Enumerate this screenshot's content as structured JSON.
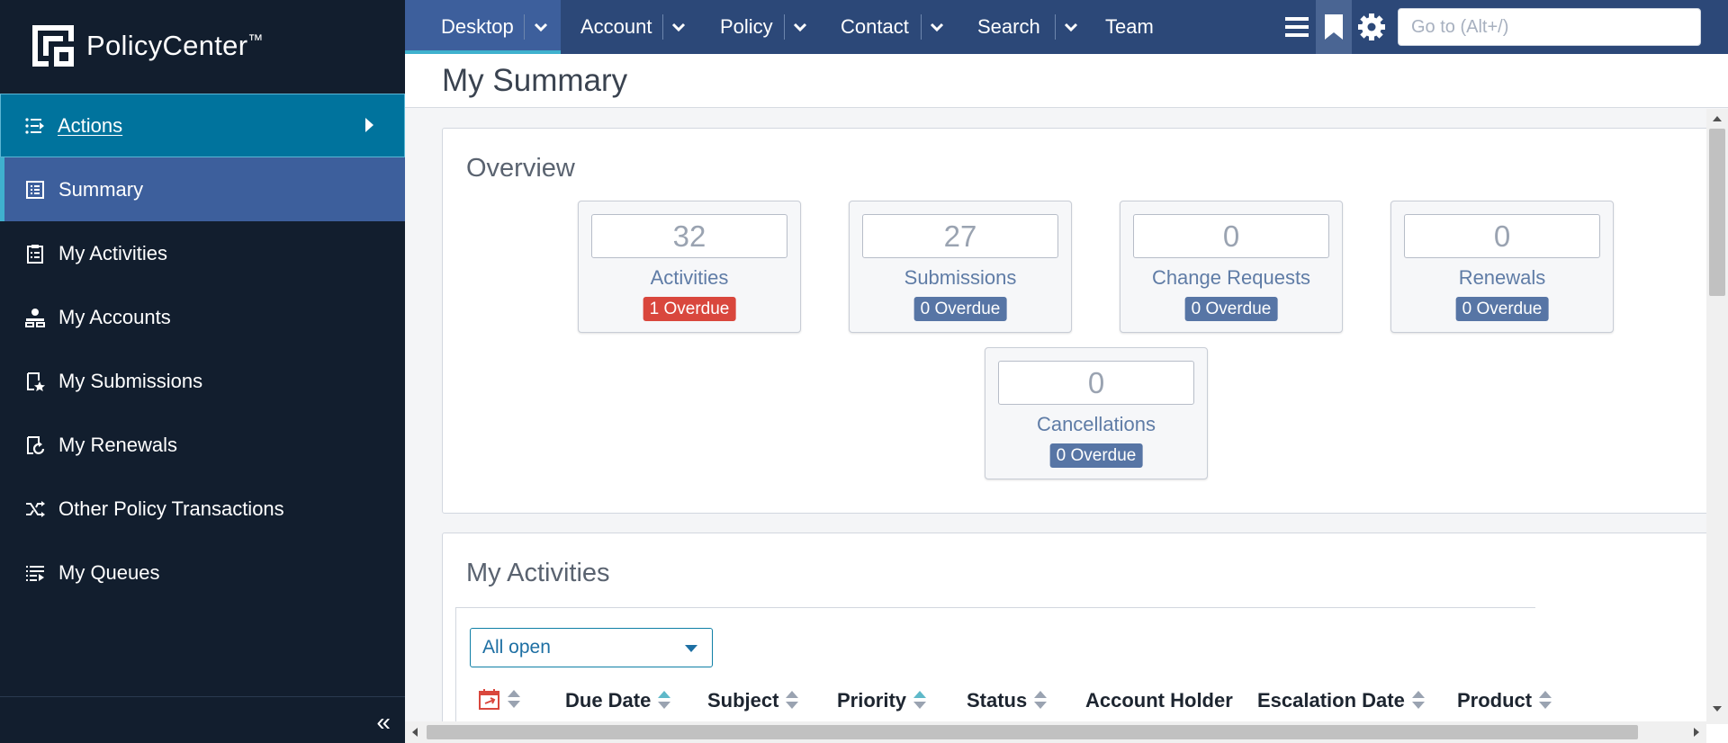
{
  "app": {
    "name": "PolicyCenter",
    "trademark": "™"
  },
  "sidebar": {
    "actions_label": "Actions",
    "items": [
      {
        "label": "Summary",
        "icon": "summary-icon"
      },
      {
        "label": "My Activities",
        "icon": "clipboard-icon"
      },
      {
        "label": "My Accounts",
        "icon": "accounts-icon"
      },
      {
        "label": "My Submissions",
        "icon": "submissions-icon"
      },
      {
        "label": "My Renewals",
        "icon": "renewals-icon"
      },
      {
        "label": "Other Policy Transactions",
        "icon": "shuffle-icon"
      },
      {
        "label": "My Queues",
        "icon": "queue-list-icon"
      }
    ],
    "collapse_glyph": "«"
  },
  "topnav": {
    "tabs": [
      {
        "label": "Desktop"
      },
      {
        "label": "Account"
      },
      {
        "label": "Policy"
      },
      {
        "label": "Contact"
      },
      {
        "label": "Search"
      },
      {
        "label": "Team"
      }
    ],
    "goto_placeholder": "Go to (Alt+/)"
  },
  "page": {
    "title": "My Summary"
  },
  "overview": {
    "title": "Overview",
    "stats": [
      {
        "value": "32",
        "label": "Activities",
        "badge": "1 Overdue",
        "alert": true
      },
      {
        "value": "27",
        "label": "Submissions",
        "badge": "0 Overdue",
        "alert": false
      },
      {
        "value": "0",
        "label": "Change Requests",
        "badge": "0 Overdue",
        "alert": false
      },
      {
        "value": "0",
        "label": "Renewals",
        "badge": "0 Overdue",
        "alert": false
      },
      {
        "value": "0",
        "label": "Cancellations",
        "badge": "0 Overdue",
        "alert": false
      }
    ]
  },
  "activities": {
    "title": "My Activities",
    "filter": "All open",
    "columns": [
      "Due Date",
      "Subject",
      "Priority",
      "Status",
      "Account Holder",
      "Escalation Date",
      "Product"
    ]
  },
  "colors": {
    "sidebar_bg": "#121e2e",
    "topbar_bg": "#2c4878",
    "actions_bg": "#00739d",
    "active_item_bg": "#3d5f9c",
    "badge_alert": "#d9473d",
    "badge_default": "#5775a5"
  }
}
